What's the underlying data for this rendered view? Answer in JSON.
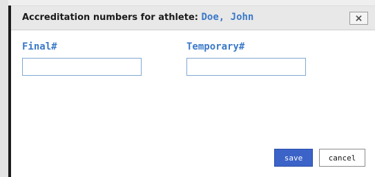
{
  "dialog": {
    "title_prefix": "Accreditation numbers for athlete:",
    "athlete_name": "Doe, John",
    "close_label": "×"
  },
  "fields": {
    "final_label": "Final#",
    "final_value": "",
    "temporary_label": "Temporary#",
    "temporary_value": ""
  },
  "buttons": {
    "save_label": "save",
    "cancel_label": "cancel"
  },
  "colors": {
    "accent": "#3b79c9",
    "save_button": "#3b63c8",
    "titlebar": "#e8e8e8"
  }
}
